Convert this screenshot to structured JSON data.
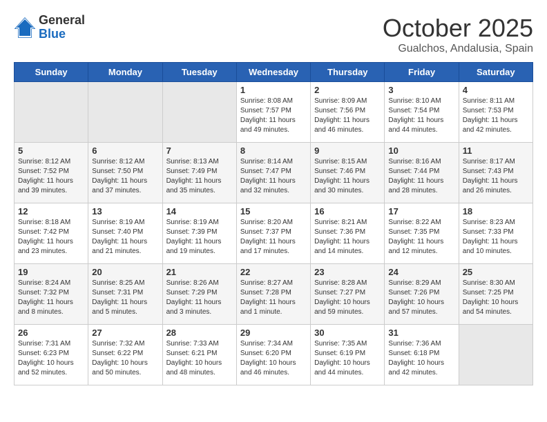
{
  "logo": {
    "general": "General",
    "blue": "Blue"
  },
  "header": {
    "month": "October 2025",
    "location": "Gualchos, Andalusia, Spain"
  },
  "weekdays": [
    "Sunday",
    "Monday",
    "Tuesday",
    "Wednesday",
    "Thursday",
    "Friday",
    "Saturday"
  ],
  "weeks": [
    [
      {
        "day": "",
        "empty": true
      },
      {
        "day": "",
        "empty": true
      },
      {
        "day": "",
        "empty": true
      },
      {
        "day": "1",
        "sunrise": "8:08 AM",
        "sunset": "7:57 PM",
        "daylight": "11 hours and 49 minutes."
      },
      {
        "day": "2",
        "sunrise": "8:09 AM",
        "sunset": "7:56 PM",
        "daylight": "11 hours and 46 minutes."
      },
      {
        "day": "3",
        "sunrise": "8:10 AM",
        "sunset": "7:54 PM",
        "daylight": "11 hours and 44 minutes."
      },
      {
        "day": "4",
        "sunrise": "8:11 AM",
        "sunset": "7:53 PM",
        "daylight": "11 hours and 42 minutes."
      }
    ],
    [
      {
        "day": "5",
        "sunrise": "8:12 AM",
        "sunset": "7:52 PM",
        "daylight": "11 hours and 39 minutes."
      },
      {
        "day": "6",
        "sunrise": "8:12 AM",
        "sunset": "7:50 PM",
        "daylight": "11 hours and 37 minutes."
      },
      {
        "day": "7",
        "sunrise": "8:13 AM",
        "sunset": "7:49 PM",
        "daylight": "11 hours and 35 minutes."
      },
      {
        "day": "8",
        "sunrise": "8:14 AM",
        "sunset": "7:47 PM",
        "daylight": "11 hours and 32 minutes."
      },
      {
        "day": "9",
        "sunrise": "8:15 AM",
        "sunset": "7:46 PM",
        "daylight": "11 hours and 30 minutes."
      },
      {
        "day": "10",
        "sunrise": "8:16 AM",
        "sunset": "7:44 PM",
        "daylight": "11 hours and 28 minutes."
      },
      {
        "day": "11",
        "sunrise": "8:17 AM",
        "sunset": "7:43 PM",
        "daylight": "11 hours and 26 minutes."
      }
    ],
    [
      {
        "day": "12",
        "sunrise": "8:18 AM",
        "sunset": "7:42 PM",
        "daylight": "11 hours and 23 minutes."
      },
      {
        "day": "13",
        "sunrise": "8:19 AM",
        "sunset": "7:40 PM",
        "daylight": "11 hours and 21 minutes."
      },
      {
        "day": "14",
        "sunrise": "8:19 AM",
        "sunset": "7:39 PM",
        "daylight": "11 hours and 19 minutes."
      },
      {
        "day": "15",
        "sunrise": "8:20 AM",
        "sunset": "7:37 PM",
        "daylight": "11 hours and 17 minutes."
      },
      {
        "day": "16",
        "sunrise": "8:21 AM",
        "sunset": "7:36 PM",
        "daylight": "11 hours and 14 minutes."
      },
      {
        "day": "17",
        "sunrise": "8:22 AM",
        "sunset": "7:35 PM",
        "daylight": "11 hours and 12 minutes."
      },
      {
        "day": "18",
        "sunrise": "8:23 AM",
        "sunset": "7:33 PM",
        "daylight": "11 hours and 10 minutes."
      }
    ],
    [
      {
        "day": "19",
        "sunrise": "8:24 AM",
        "sunset": "7:32 PM",
        "daylight": "11 hours and 8 minutes."
      },
      {
        "day": "20",
        "sunrise": "8:25 AM",
        "sunset": "7:31 PM",
        "daylight": "11 hours and 5 minutes."
      },
      {
        "day": "21",
        "sunrise": "8:26 AM",
        "sunset": "7:29 PM",
        "daylight": "11 hours and 3 minutes."
      },
      {
        "day": "22",
        "sunrise": "8:27 AM",
        "sunset": "7:28 PM",
        "daylight": "11 hours and 1 minute."
      },
      {
        "day": "23",
        "sunrise": "8:28 AM",
        "sunset": "7:27 PM",
        "daylight": "10 hours and 59 minutes."
      },
      {
        "day": "24",
        "sunrise": "8:29 AM",
        "sunset": "7:26 PM",
        "daylight": "10 hours and 57 minutes."
      },
      {
        "day": "25",
        "sunrise": "8:30 AM",
        "sunset": "7:25 PM",
        "daylight": "10 hours and 54 minutes."
      }
    ],
    [
      {
        "day": "26",
        "sunrise": "7:31 AM",
        "sunset": "6:23 PM",
        "daylight": "10 hours and 52 minutes."
      },
      {
        "day": "27",
        "sunrise": "7:32 AM",
        "sunset": "6:22 PM",
        "daylight": "10 hours and 50 minutes."
      },
      {
        "day": "28",
        "sunrise": "7:33 AM",
        "sunset": "6:21 PM",
        "daylight": "10 hours and 48 minutes."
      },
      {
        "day": "29",
        "sunrise": "7:34 AM",
        "sunset": "6:20 PM",
        "daylight": "10 hours and 46 minutes."
      },
      {
        "day": "30",
        "sunrise": "7:35 AM",
        "sunset": "6:19 PM",
        "daylight": "10 hours and 44 minutes."
      },
      {
        "day": "31",
        "sunrise": "7:36 AM",
        "sunset": "6:18 PM",
        "daylight": "10 hours and 42 minutes."
      },
      {
        "day": "",
        "empty": true
      }
    ]
  ]
}
